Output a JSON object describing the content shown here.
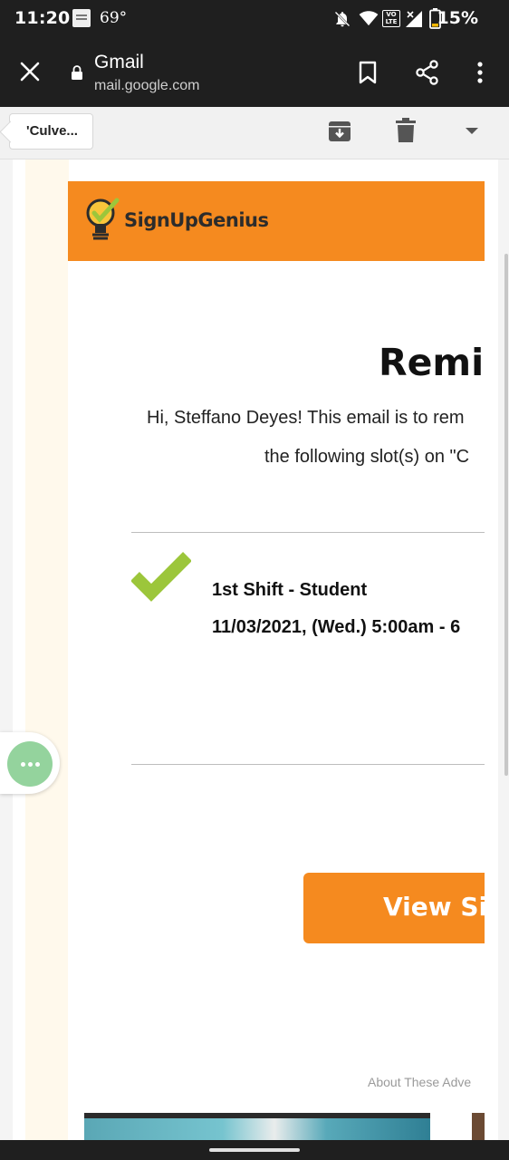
{
  "status_bar": {
    "time": "11:20",
    "temperature": "69°",
    "battery_percent": "15%",
    "icons": [
      "bible-app-icon",
      "notifications-off-icon",
      "wifi-icon",
      "volte-icon",
      "signal-icon",
      "battery-icon"
    ]
  },
  "toolbar": {
    "title": "Gmail",
    "url": "mail.google.com",
    "icons": [
      "close-icon",
      "lock-icon",
      "bookmark-icon",
      "share-icon",
      "more-vert-icon"
    ]
  },
  "gmail_bar": {
    "back_label": "'Culve...",
    "icons": [
      "archive-icon",
      "delete-icon",
      "dropdown-icon"
    ]
  },
  "email": {
    "brand": "SignUpGenius",
    "title": "Remin",
    "greeting_line1": "Hi, Steffano Deyes! This email is to rem",
    "greeting_line2": "the following slot(s) on \"C",
    "slot": {
      "name": "1st Shift - Student",
      "datetime": "11/03/2021, (Wed.) 5:00am - 6"
    },
    "cta_label": "View Sig",
    "ads_label": "About These Adve"
  },
  "colors": {
    "brand_orange": "#f58a1f",
    "check_green": "#9cc63b",
    "bubble_green": "#94d39d",
    "dark_chrome": "#1f1f1f"
  }
}
